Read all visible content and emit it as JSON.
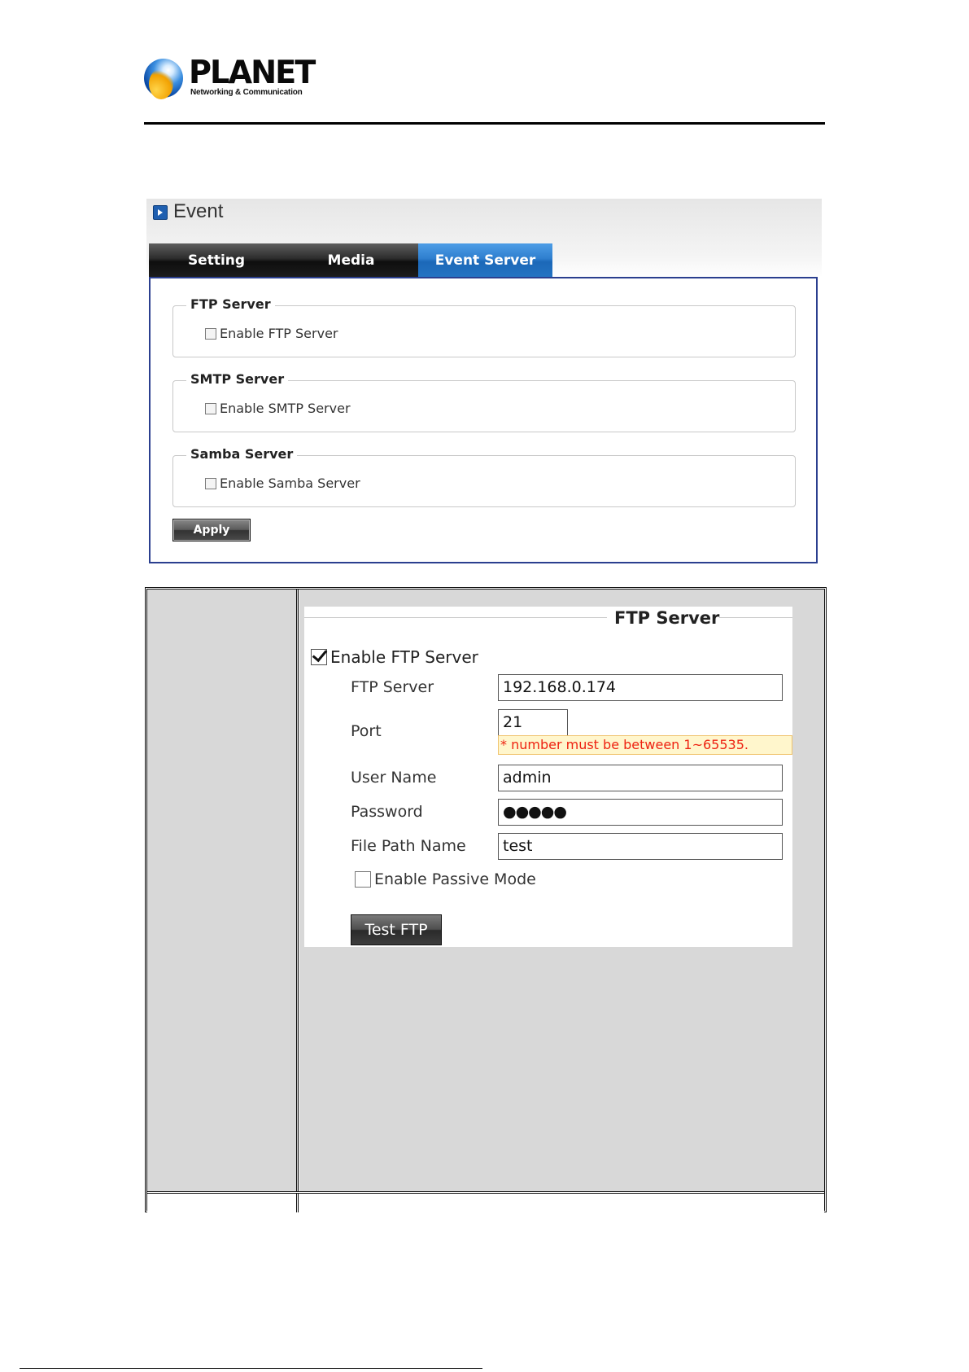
{
  "brand": {
    "name": "PLANET",
    "tagline": "Networking & Communication"
  },
  "event": {
    "title": "Event",
    "tabs": [
      {
        "label": "Setting",
        "active": false
      },
      {
        "label": "Media",
        "active": false
      },
      {
        "label": "Event Server",
        "active": true
      }
    ],
    "sections": [
      {
        "legend": "FTP Server",
        "option": "Enable FTP Server",
        "checked": false
      },
      {
        "legend": "SMTP Server",
        "option": "Enable SMTP Server",
        "checked": false
      },
      {
        "legend": "Samba Server",
        "option": "Enable Samba Server",
        "checked": false
      }
    ],
    "apply_label": "Apply"
  },
  "ftp": {
    "legend": "FTP Server",
    "enable_label": "Enable FTP Server",
    "enable_checked": true,
    "fields": {
      "server": {
        "label": "FTP Server",
        "value": "192.168.0.174"
      },
      "port": {
        "label": "Port",
        "value": "21",
        "hint": "* number must be between 1~65535."
      },
      "username": {
        "label": "User Name",
        "value": "admin"
      },
      "password": {
        "label": "Password",
        "value": "●●●●●"
      },
      "filepath": {
        "label": "File Path Name",
        "value": "test"
      }
    },
    "passive_label": "Enable Passive Mode",
    "passive_checked": false,
    "test_label": "Test FTP"
  },
  "colors": {
    "active_tab": "#2f7fcf",
    "panel_border": "#2b3f8f",
    "hint_text": "#ee2211"
  }
}
